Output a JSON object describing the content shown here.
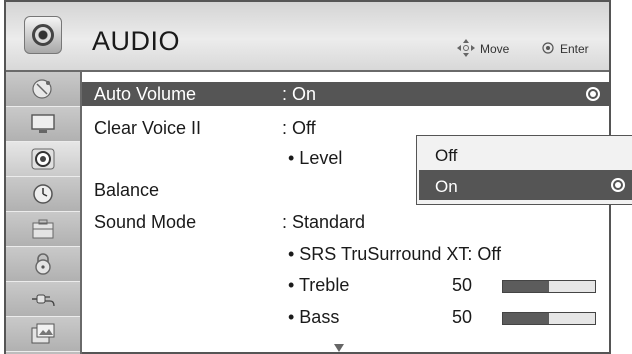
{
  "header": {
    "title": "AUDIO",
    "hint_move": "Move",
    "hint_enter": "Enter",
    "icon": "speaker-icon"
  },
  "sidebar": {
    "items": [
      {
        "icon": "satellite-dish-icon"
      },
      {
        "icon": "tv-monitor-icon"
      },
      {
        "icon": "speaker-icon",
        "active": true
      },
      {
        "icon": "clock-icon"
      },
      {
        "icon": "toolbox-icon"
      },
      {
        "icon": "lock-icon"
      },
      {
        "icon": "input-plug-icon"
      },
      {
        "icon": "photo-icon"
      }
    ]
  },
  "menu": {
    "auto_volume": {
      "label": "Auto Volume",
      "value": ": On"
    },
    "clear_voice": {
      "label": "Clear Voice II",
      "value": ": Off"
    },
    "level": {
      "label": "• Level"
    },
    "balance": {
      "label": "Balance"
    },
    "sound_mode": {
      "label": "Sound Mode",
      "value": ": Standard"
    },
    "srs": {
      "label": "• SRS TruSurround XT: Off"
    },
    "treble": {
      "label": "• Treble",
      "value": "50",
      "level": 0.5
    },
    "bass": {
      "label": "• Bass",
      "value": "50",
      "level": 0.5
    }
  },
  "popup": {
    "options": [
      {
        "label": "Off",
        "selected": false
      },
      {
        "label": "On",
        "selected": true
      }
    ]
  },
  "colors": {
    "highlight": "#555555",
    "header_bg": "#e0e0e0",
    "sidebar_bg": "#bdbdbd"
  }
}
